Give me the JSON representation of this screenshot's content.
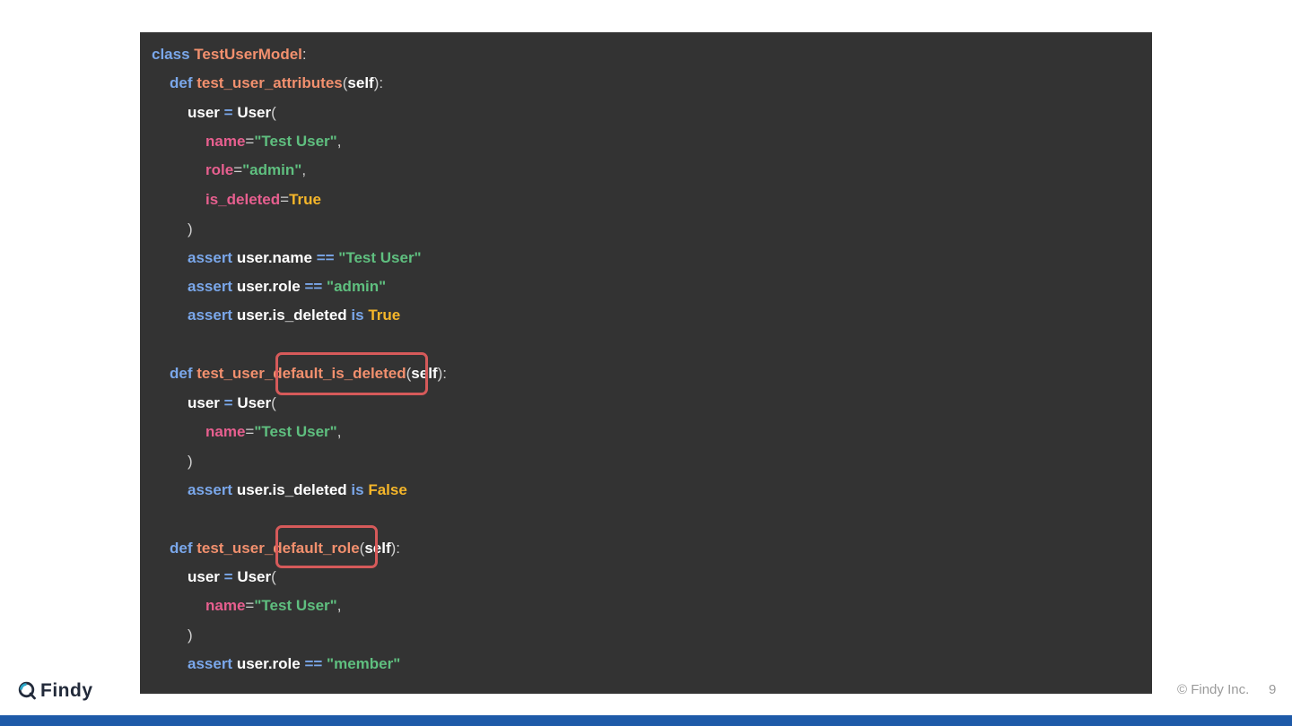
{
  "code": {
    "class_kw": "class",
    "class_name": "TestUserModel",
    "colon": ":",
    "def_kw": "def",
    "self_kw": "self",
    "fn1": "test_user_attributes",
    "fn2_prefix": "test_user_",
    "fn2_highlight": "default_is_deleted",
    "fn3_prefix": "test_user_",
    "fn3_highlight": "default_role",
    "user_var": "user",
    "eq": "=",
    "user_cls": "User",
    "open_paren": "(",
    "close_paren": ")",
    "params_close": "):",
    "comma": ",",
    "arg_name": "name",
    "arg_role": "role",
    "arg_is_deleted": "is_deleted",
    "str_test_user": "\"Test User\"",
    "str_admin": "\"admin\"",
    "str_member": "\"member\"",
    "true_val": "True",
    "false_val": "False",
    "assert_kw": "assert",
    "attr_name": "user.name",
    "attr_role": "user.role",
    "attr_is_deleted": "user.is_deleted",
    "op_eqeq": "==",
    "op_is": "is"
  },
  "footer": {
    "brand": "Findy",
    "copyright": "© Findy Inc.",
    "page_number": "9"
  },
  "colors": {
    "panel_bg": "#333333",
    "keyword": "#7aa7ea",
    "function": "#f2906e",
    "argument": "#e75f8f",
    "string": "#5fbf7f",
    "boolean": "#f5b62a",
    "highlight_border": "#d65a5a",
    "brand_bar": "#1e5aa8"
  }
}
